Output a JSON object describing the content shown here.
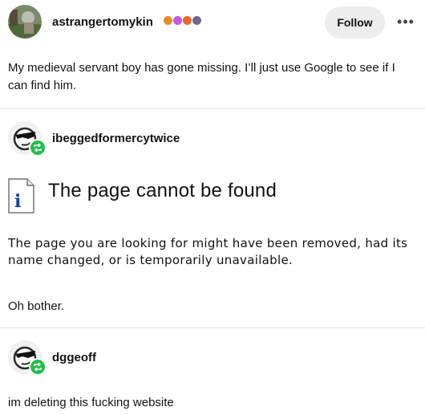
{
  "original_post": {
    "username": "astrangertomykin",
    "text": "My medieval servant boy has gone missing. I’ll just use Google to see if I can find him.",
    "badges": [
      "#e88a2a",
      "#c55ae0",
      "#e8672a",
      "#6a6a8a"
    ],
    "follow_label": "Follow",
    "more_label": "•••"
  },
  "reblog1": {
    "username": "ibeggedformercytwice",
    "error_title": "The page cannot be found",
    "error_body": "The page you are looking for might have been removed, had its name changed, or is temporarily unavailable.",
    "text": "Oh bother."
  },
  "reblog2": {
    "username": "dggeoff",
    "text": "im deleting this fucking website"
  },
  "colors": {
    "reblog_green": "#1fbf4a",
    "follow_bg": "#ededed"
  }
}
